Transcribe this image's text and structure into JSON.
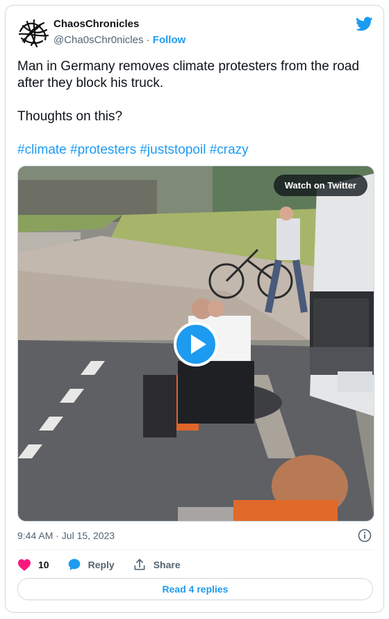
{
  "tweet": {
    "author_name": "ChaosChronicles",
    "author_handle": "@Cha0sChr0nicles",
    "separator": " · ",
    "follow_label": "Follow",
    "text_line_1": "Man in Germany removes climate protesters from the road after they block his truck.",
    "text_line_2": "Thoughts on this?",
    "hashtags": "#climate #protesters #juststopoil #crazy",
    "timestamp": "9:44 AM · Jul 15, 2023"
  },
  "media": {
    "watch_label": "Watch on Twitter",
    "type": "video"
  },
  "actions": {
    "like_count": "10",
    "reply_label": "Reply",
    "share_label": "Share",
    "read_replies_label": "Read 4 replies"
  },
  "colors": {
    "accent": "#1d9bf0",
    "like": "#f91880",
    "secondary_text": "#536471"
  },
  "icons": [
    "avatar-logo",
    "twitter-bird-icon",
    "play-icon",
    "info-icon",
    "heart-icon",
    "reply-bubble-icon",
    "share-icon"
  ]
}
